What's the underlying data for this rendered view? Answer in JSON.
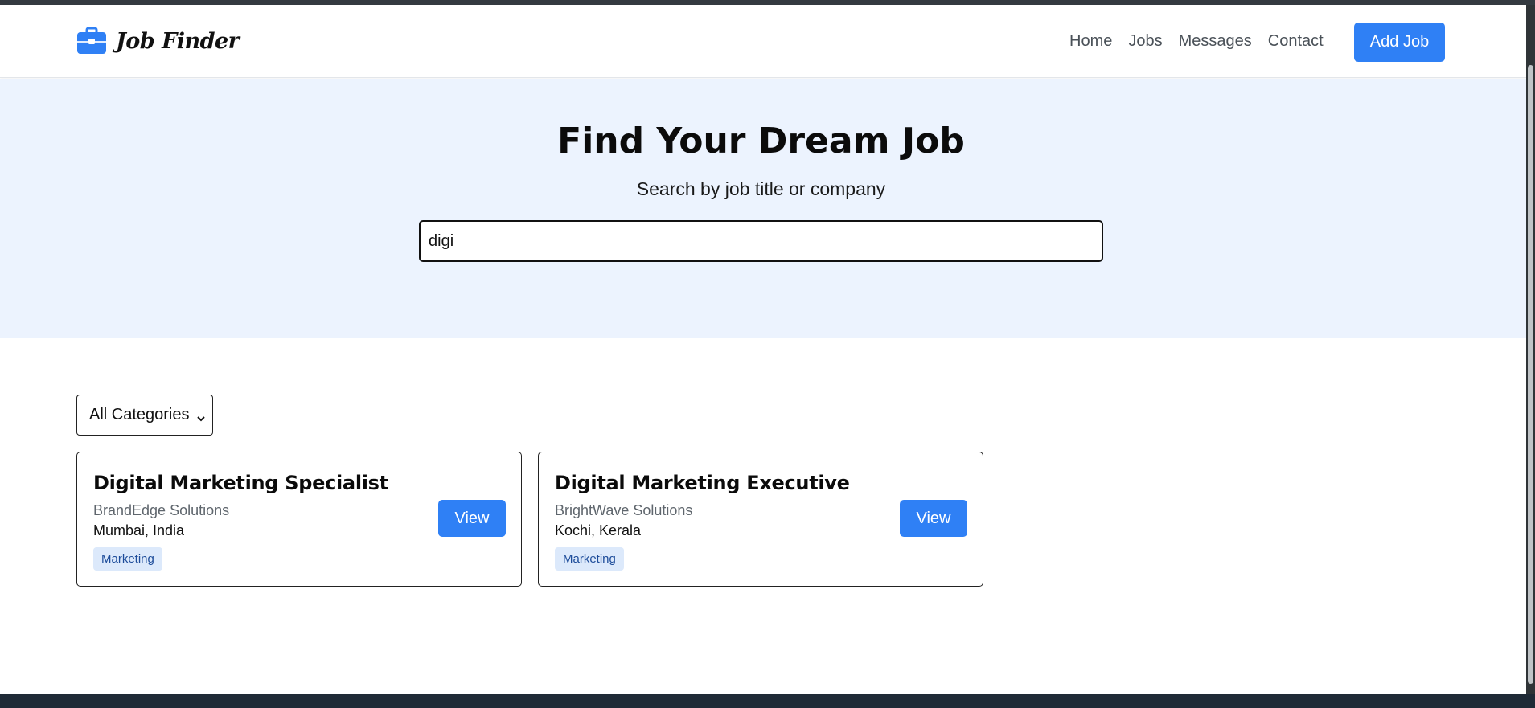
{
  "navbar": {
    "brand": "Job Finder",
    "brand_icon": "briefcase-icon",
    "links": [
      "Home",
      "Jobs",
      "Messages",
      "Contact"
    ],
    "add_job_label": "Add Job"
  },
  "hero": {
    "title": "Find Your Dream Job",
    "subtitle": "Search by job title or company",
    "search_value": "digi"
  },
  "filter": {
    "selected_category": "All Categories"
  },
  "jobs": [
    {
      "title": "Digital Marketing Specialist",
      "company": "BrandEdge Solutions",
      "location": "Mumbai, India",
      "category": "Marketing",
      "view_label": "View"
    },
    {
      "title": "Digital Marketing Executive",
      "company": "BrightWave Solutions",
      "location": "Kochi, Kerala",
      "category": "Marketing",
      "view_label": "View"
    }
  ],
  "colors": {
    "accent": "#2f80f5",
    "hero_bg": "#ecf3fe",
    "badge_bg": "#dce9fb",
    "badge_text": "#1d4c9a"
  }
}
